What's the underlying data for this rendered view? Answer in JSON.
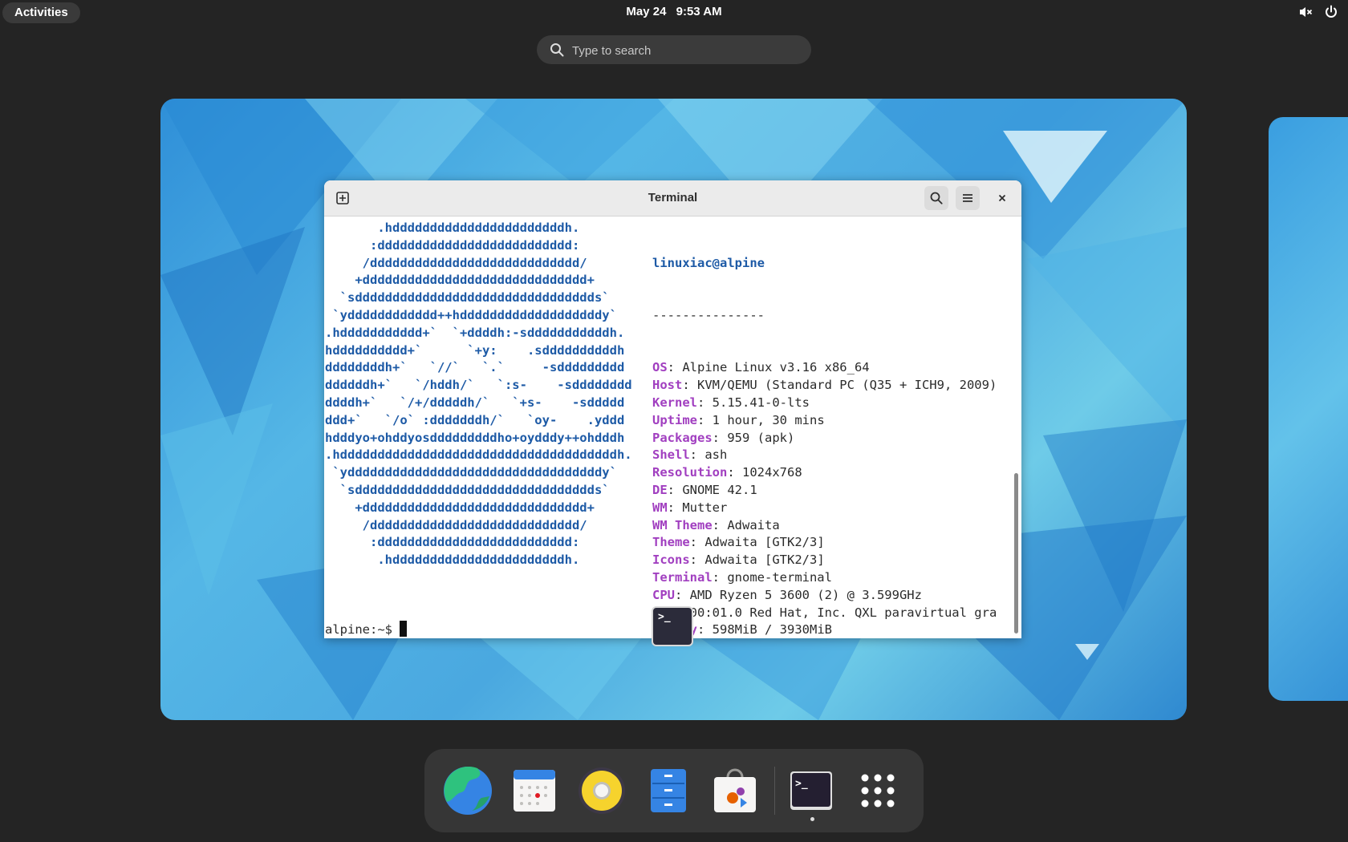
{
  "topbar": {
    "activities_label": "Activities",
    "date": "May 24",
    "time": "9:53 AM",
    "icons": [
      "volume-muted-icon",
      "power-icon"
    ]
  },
  "search": {
    "placeholder": "Type to search"
  },
  "terminal": {
    "title": "Terminal",
    "ascii_art": "       .hdddddddddddddddddddddddh.\n      :dddddddddddddddddddddddddd:\n     /dddddddddddddddddddddddddddd/\n    +dddddddddddddddddddddddddddddd+\n  `sdddddddddddddddddddddddddddddddds`\n `ydddddddddddd++hdddddddddddddddddddy`\n.hddddddddddd+`  `+ddddh:-sdddddddddddh.\nhdddddddddd+`      `+y:    .sddddddddddh\nddddddddh+`   `//`   `.`     -sddddddddd\nddddddh+`   `/hddh/`   `:s-    -sdddddddd\nddddh+`   `/+/dddddh/`   `+s-    -sddddd\nddd+`   `/o` :dddddddh/`   `oy-    .yddd\nhdddyo+ohddyosdddddddddho+oydddy++ohdddh\n.hdddddddddddddddddddddddddddddddddddddh.\n `yddddddddddddddddddddddddddddddddddy`\n  `sdddddddddddddddddddddddddddddddds`\n    +dddddddddddddddddddddddddddddd+\n     /dddddddddddddddddddddddddddd/\n      :dddddddddddddddddddddddddd:\n       .hdddddddddddddddddddddddh.",
    "user_host": "linuxiac@alpine",
    "separator": "---------------",
    "info": [
      {
        "key": "OS",
        "value": "Alpine Linux v3.16 x86_64"
      },
      {
        "key": "Host",
        "value": "KVM/QEMU (Standard PC (Q35 + ICH9, 2009)"
      },
      {
        "key": "Kernel",
        "value": "5.15.41-0-lts"
      },
      {
        "key": "Uptime",
        "value": "1 hour, 30 mins"
      },
      {
        "key": "Packages",
        "value": "959 (apk)"
      },
      {
        "key": "Shell",
        "value": "ash"
      },
      {
        "key": "Resolution",
        "value": "1024x768"
      },
      {
        "key": "DE",
        "value": "GNOME 42.1"
      },
      {
        "key": "WM",
        "value": "Mutter"
      },
      {
        "key": "WM Theme",
        "value": "Adwaita"
      },
      {
        "key": "Theme",
        "value": "Adwaita [GTK2/3]"
      },
      {
        "key": "Icons",
        "value": "Adwaita [GTK2/3]"
      },
      {
        "key": "Terminal",
        "value": "gnome-terminal"
      },
      {
        "key": "CPU",
        "value": "AMD Ryzen 5 3600 (2) @ 3.599GHz"
      },
      {
        "key": "GPU",
        "value": "00:01.0 Red Hat, Inc. QXL paravirtual gra"
      },
      {
        "key": "Memory",
        "value": "598MiB / 3930MiB"
      }
    ],
    "palette_row1": [
      "#171421",
      "#c01c28",
      "#26a269",
      "#a2734c",
      "#12488b",
      "#a347ba",
      "#2aa1b3",
      "#d0cfcc"
    ],
    "palette_row2": [
      "#5e5c64",
      "#f66151",
      "#33d17a",
      "#e9ad0c",
      "#2a7bde",
      "#c061cb",
      "#33c7de"
    ],
    "prompt": "alpine:~$ ",
    "window_icon_glyph": ">_"
  },
  "dock": {
    "apps": [
      "web-browser-icon",
      "calendar-icon",
      "rhythmbox-icon",
      "files-icon",
      "software-icon",
      "terminal-icon",
      "app-grid-icon"
    ],
    "terminal_glyph": ">_"
  },
  "colors": {
    "accent_blue": "#1d5aa6",
    "accent_purple": "#a13fc0",
    "desktop_bg": "#242424"
  }
}
